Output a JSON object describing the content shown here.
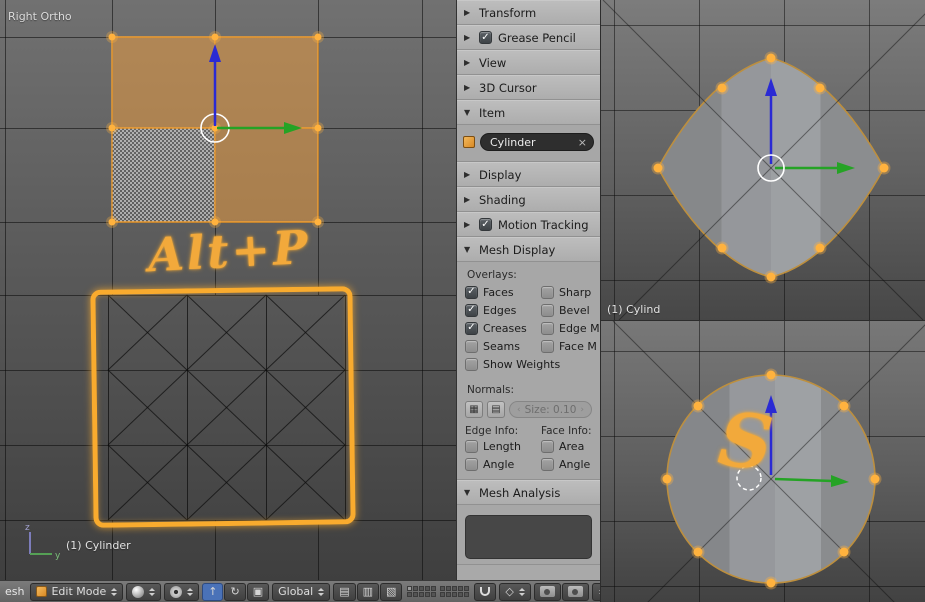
{
  "left_viewport": {
    "view_label": "Right Ortho",
    "annotation": "Alt+P",
    "status_text": "(1) Cylinder",
    "axis_z_label": "z",
    "axis_y_label": "y"
  },
  "right_top_viewport": {
    "status_text": "(1) Cylind"
  },
  "right_bottom_viewport": {
    "annotation": "S"
  },
  "panel": {
    "sections": [
      {
        "label": "Transform",
        "expanded": false
      },
      {
        "label": "Grease Pencil",
        "expanded": false,
        "checked": true
      },
      {
        "label": "View",
        "expanded": false
      },
      {
        "label": "3D Cursor",
        "expanded": false
      },
      {
        "label": "Item",
        "expanded": true
      },
      {
        "label": "Display",
        "expanded": false
      },
      {
        "label": "Shading",
        "expanded": false
      },
      {
        "label": "Motion Tracking",
        "expanded": false,
        "checked": true
      },
      {
        "label": "Mesh Display",
        "expanded": true
      },
      {
        "label": "Mesh Analysis",
        "expanded": true
      }
    ],
    "item": {
      "object_name": "Cylinder"
    },
    "mesh_display": {
      "overlays_label": "Overlays:",
      "col1": [
        {
          "label": "Faces",
          "checked": true
        },
        {
          "label": "Edges",
          "checked": true
        },
        {
          "label": "Creases",
          "checked": true
        },
        {
          "label": "Seams",
          "checked": false
        },
        {
          "label": "Show Weights",
          "checked": false
        }
      ],
      "col2": [
        {
          "label": "Sharp",
          "checked": false
        },
        {
          "label": "Bevel",
          "checked": false
        },
        {
          "label": "Edge M",
          "checked": false
        },
        {
          "label": "Face M",
          "checked": false
        }
      ],
      "normals_label": "Normals:",
      "normals_size": "Size: 0.10",
      "edge_info_label": "Edge Info:",
      "face_info_label": "Face Info:",
      "edge_info": [
        {
          "label": "Length",
          "checked": false
        },
        {
          "label": "Angle",
          "checked": false
        }
      ],
      "face_info": [
        {
          "label": "Area",
          "checked": false
        },
        {
          "label": "Angle",
          "checked": false
        }
      ]
    }
  },
  "header": {
    "mesh_menu_label": "esh",
    "mode_selector": "Edit Mode",
    "orientation_selector": "Global"
  },
  "icons": {
    "collapsed": "▶",
    "expanded": "▼",
    "check": "✓",
    "clear": "×",
    "translate": "↑",
    "rotate": "↻",
    "scale": "▣",
    "slider_left": "‹",
    "slider_right": "›",
    "normals_button_1": "▦",
    "normals_button_2": "▤",
    "tool_1": "▤",
    "tool_2": "▥",
    "tool_3": "▧",
    "snap_target": "◇"
  },
  "colors": {
    "selection_orange": "#ffb23e",
    "annotation_orange": "#f2a93b",
    "axis_blue": "#2a2ad4",
    "axis_green": "#25a325"
  }
}
